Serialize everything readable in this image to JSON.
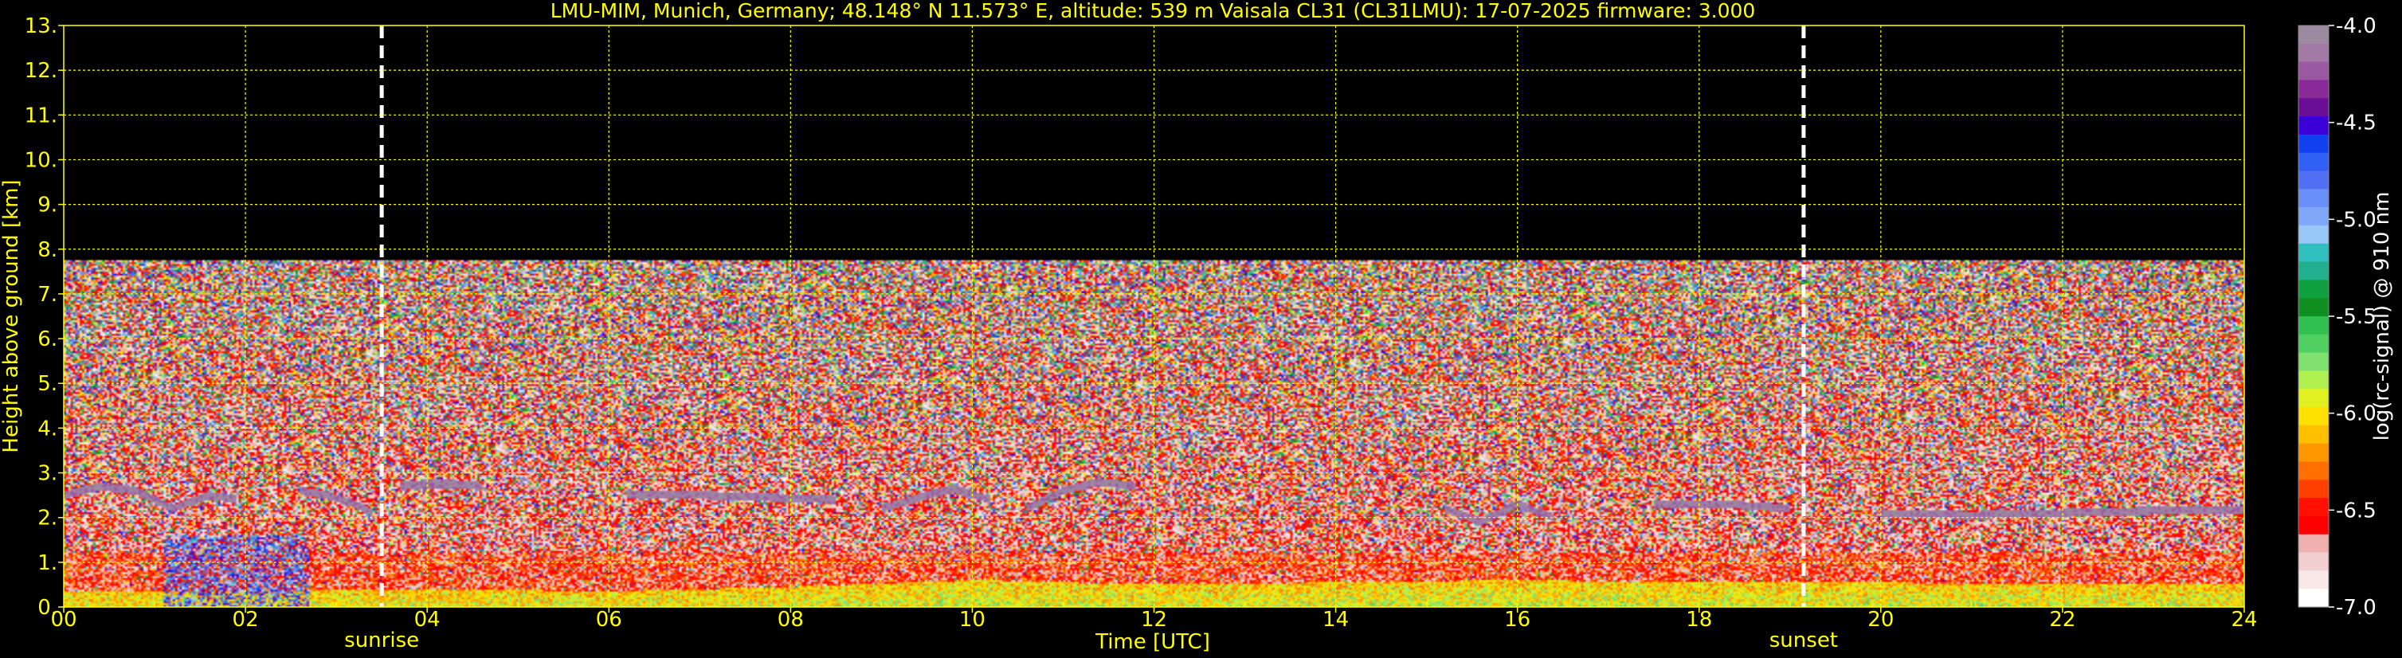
{
  "chart_data": {
    "type": "heatmap",
    "title": "LMU-MIM, Munich, Germany; 48.148° N 11.573° E, altitude: 539 m    Vaisala CL31 (CL31LMU): 17-07-2025    firmware: 3.000",
    "xlabel": "Time [UTC]",
    "ylabel": "Height above ground [km]",
    "xlim": [
      0,
      24
    ],
    "ylim": [
      0,
      13
    ],
    "x_ticks": [
      "00",
      "02",
      "04",
      "06",
      "08",
      "10",
      "12",
      "14",
      "16",
      "18",
      "20",
      "22",
      "24"
    ],
    "x_minor_ticks": [
      1,
      3,
      5,
      7,
      9,
      11,
      13,
      15,
      17,
      19,
      21,
      23
    ],
    "y_ticks": [
      "0.",
      "1.",
      "2.",
      "3.",
      "4.",
      "5.",
      "6.",
      "7.",
      "8.",
      "9.",
      "10.",
      "11.",
      "12.",
      "13."
    ],
    "grid": true,
    "grid_color": "#ffff00",
    "text_color": "#ffff00",
    "background": "#000000",
    "colorbar": {
      "label": "log(rc-signal) @ 910 nm",
      "min": -7.0,
      "max": -4.0,
      "ticks": [
        "-4.0",
        "-4.5",
        "-5.0",
        "-5.5",
        "-6.0",
        "-6.5",
        "-7.0"
      ],
      "colors": [
        "#9c8aa0",
        "#a27aa5",
        "#9a58a0",
        "#8a2a98",
        "#6a0e96",
        "#3a00d8",
        "#1040f0",
        "#3060f4",
        "#5070f4",
        "#6890f8",
        "#80a8f8",
        "#98c8f8",
        "#30c0c0",
        "#20b090",
        "#10a040",
        "#109020",
        "#30c050",
        "#50d060",
        "#80e070",
        "#b0f050",
        "#e0f020",
        "#ffe000",
        "#ffc000",
        "#ff9800",
        "#ff7000",
        "#ff4000",
        "#ff1000",
        "#ff0000",
        "#f0b0b0",
        "#f0d0d0",
        "#f8e8e8",
        "#ffffff"
      ]
    },
    "markers": [
      {
        "label": "sunrise",
        "x": 3.5
      },
      {
        "label": "sunset",
        "x": 19.15
      }
    ],
    "signal_top_km": 7.75,
    "cloud_layers": [
      {
        "x": [
          0.0,
          0.4,
          0.8,
          1.2,
          1.6,
          1.9
        ],
        "y": [
          2.5,
          2.7,
          2.6,
          2.2,
          2.5,
          2.4
        ]
      },
      {
        "x": [
          2.6,
          2.9,
          3.2,
          3.4
        ],
        "y": [
          2.6,
          2.5,
          2.3,
          2.1
        ]
      },
      {
        "x": [
          3.7,
          4.0,
          4.3,
          4.6
        ],
        "y": [
          2.7,
          2.75,
          2.75,
          2.7
        ]
      },
      {
        "x": [
          6.2,
          7.0,
          7.8,
          8.5
        ],
        "y": [
          2.5,
          2.5,
          2.45,
          2.4
        ]
      },
      {
        "x": [
          9.0,
          9.5,
          9.8,
          10.2
        ],
        "y": [
          2.2,
          2.5,
          2.65,
          2.4
        ]
      },
      {
        "x": [
          10.6,
          11.0,
          11.4,
          11.8
        ],
        "y": [
          2.2,
          2.6,
          2.8,
          2.7
        ]
      },
      {
        "x": [
          15.2,
          15.6,
          16.0,
          16.4
        ],
        "y": [
          2.2,
          1.9,
          2.3,
          2.0
        ]
      },
      {
        "x": [
          17.5,
          18.3,
          19.0
        ],
        "y": [
          2.3,
          2.3,
          2.2
        ]
      },
      {
        "x": [
          20.0,
          21.0,
          22.0,
          23.0,
          24.0
        ],
        "y": [
          2.1,
          2.05,
          2.1,
          2.15,
          2.15
        ]
      }
    ],
    "boundary_layer": {
      "x": [
        0,
        2,
        4,
        6,
        8,
        10,
        12,
        14,
        16,
        18,
        20,
        22,
        24
      ],
      "y": [
        0.35,
        0.35,
        0.4,
        0.35,
        0.45,
        0.6,
        0.5,
        0.55,
        0.6,
        0.55,
        0.55,
        0.5,
        0.5
      ]
    }
  }
}
